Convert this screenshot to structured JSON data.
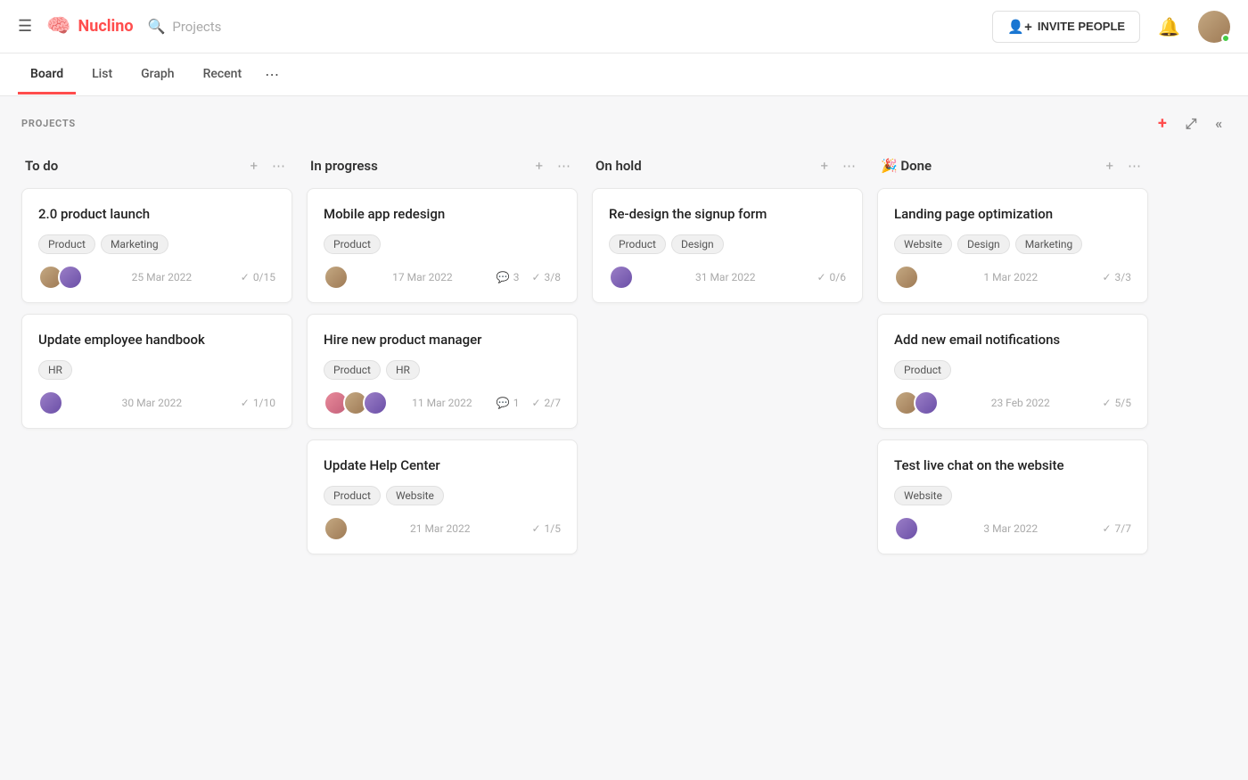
{
  "header": {
    "menu_icon": "☰",
    "logo_icon": "🧠",
    "logo_text": "Nuclino",
    "search_placeholder": "Projects",
    "search_icon": "🔍",
    "invite_btn": "INVITE PEOPLE",
    "invite_icon": "👤",
    "bell_icon": "🔔"
  },
  "tabs": [
    {
      "id": "board",
      "label": "Board",
      "active": true
    },
    {
      "id": "list",
      "label": "List",
      "active": false
    },
    {
      "id": "graph",
      "label": "Graph",
      "active": false
    },
    {
      "id": "recent",
      "label": "Recent",
      "active": false
    }
  ],
  "board": {
    "section_label": "PROJECTS",
    "columns": [
      {
        "id": "todo",
        "title": "To do",
        "emoji": "",
        "cards": [
          {
            "id": "card-1",
            "title": "2.0 product launch",
            "tags": [
              "Product",
              "Marketing"
            ],
            "avatars": [
              "av1",
              "av2"
            ],
            "date": "25 Mar 2022",
            "meta": [
              {
                "icon": "✓",
                "text": "0/15"
              }
            ]
          },
          {
            "id": "card-2",
            "title": "Update employee handbook",
            "tags": [
              "HR"
            ],
            "avatars": [
              "av2"
            ],
            "date": "30 Mar 2022",
            "meta": [
              {
                "icon": "✓",
                "text": "1/10"
              }
            ]
          }
        ]
      },
      {
        "id": "in-progress",
        "title": "In progress",
        "emoji": "",
        "cards": [
          {
            "id": "card-3",
            "title": "Mobile app redesign",
            "tags": [
              "Product"
            ],
            "avatars": [
              "av1"
            ],
            "date": "17 Mar 2022",
            "meta": [
              {
                "icon": "💬",
                "text": "3"
              },
              {
                "icon": "✓",
                "text": "3/8"
              }
            ]
          },
          {
            "id": "card-4",
            "title": "Hire new product manager",
            "tags": [
              "Product",
              "HR"
            ],
            "avatars": [
              "av3",
              "av1",
              "av2"
            ],
            "date": "11 Mar 2022",
            "meta": [
              {
                "icon": "💬",
                "text": "1"
              },
              {
                "icon": "✓",
                "text": "2/7"
              }
            ]
          },
          {
            "id": "card-5",
            "title": "Update Help Center",
            "tags": [
              "Product",
              "Website"
            ],
            "avatars": [
              "av1"
            ],
            "date": "21 Mar 2022",
            "meta": [
              {
                "icon": "✓",
                "text": "1/5"
              }
            ]
          }
        ]
      },
      {
        "id": "on-hold",
        "title": "On hold",
        "emoji": "",
        "cards": [
          {
            "id": "card-6",
            "title": "Re-design the signup form",
            "tags": [
              "Product",
              "Design"
            ],
            "avatars": [
              "av2"
            ],
            "date": "31 Mar 2022",
            "meta": [
              {
                "icon": "✓",
                "text": "0/6"
              }
            ]
          }
        ]
      },
      {
        "id": "done",
        "title": "Done",
        "emoji": "🎉",
        "cards": [
          {
            "id": "card-7",
            "title": "Landing page optimization",
            "tags": [
              "Website",
              "Design",
              "Marketing"
            ],
            "avatars": [
              "av1"
            ],
            "date": "1 Mar 2022",
            "meta": [
              {
                "icon": "✓",
                "text": "3/3"
              }
            ]
          },
          {
            "id": "card-8",
            "title": "Add new email notifications",
            "tags": [
              "Product"
            ],
            "avatars": [
              "av1",
              "av2"
            ],
            "date": "23 Feb 2022",
            "meta": [
              {
                "icon": "✓",
                "text": "5/5"
              }
            ]
          },
          {
            "id": "card-9",
            "title": "Test live chat on the website",
            "tags": [
              "Website"
            ],
            "avatars": [
              "av2"
            ],
            "date": "3 Mar 2022",
            "meta": [
              {
                "icon": "✓",
                "text": "7/7"
              }
            ]
          }
        ]
      }
    ]
  }
}
